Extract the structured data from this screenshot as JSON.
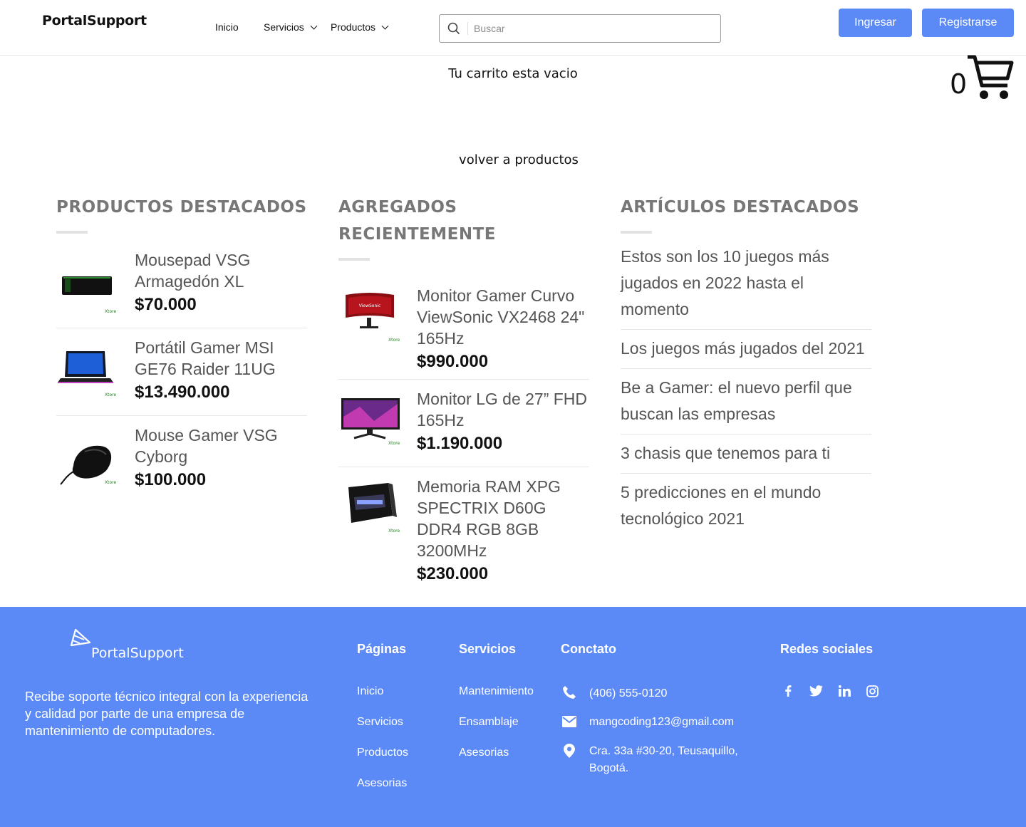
{
  "header": {
    "logo": "PortalSupport",
    "nav": [
      {
        "label": "Inicio"
      },
      {
        "label": "Servicios"
      },
      {
        "label": "Productos"
      }
    ],
    "search_placeholder": "Buscar",
    "login_label": "Ingresar",
    "register_label": "Registrarse"
  },
  "cart": {
    "empty_message": "Tu carrito esta vacio",
    "count": "0",
    "back_link": "volver a productos"
  },
  "featured": {
    "title": "PRODUCTOS DESTACADOS",
    "items": [
      {
        "name": "Mousepad VSG Armagedón XL",
        "price": "$70.000"
      },
      {
        "name": "Portátil Gamer MSI GE76 Raider 11UG",
        "price": "$13.490.000"
      },
      {
        "name": "Mouse Gamer VSG Cyborg",
        "price": "$100.000"
      }
    ]
  },
  "recent": {
    "title": "AGREGADOS RECIENTEMENTE",
    "items": [
      {
        "name": "Monitor Gamer Curvo ViewSonic VX2468 24\" 165Hz",
        "price": "$990.000"
      },
      {
        "name": "Monitor LG de 27” FHD 165Hz",
        "price": "$1.190.000"
      },
      {
        "name": "Memoria RAM XPG SPECTRIX D60G DDR4 RGB 8GB 3200MHz",
        "price": "$230.000"
      }
    ]
  },
  "articles": {
    "title": "ARTÍCULOS DESTACADOS",
    "items": [
      "Estos son los 10 juegos más jugados en 2022 hasta el momento",
      "Los juegos más jugados del 2021",
      "Be a Gamer: el nuevo perfil que buscan las empresas",
      "3 chasis que tenemos para ti",
      "5 predicciones en el mundo tecnológico 2021"
    ]
  },
  "footer": {
    "logo": "PortalSupport",
    "description": "Recibe soporte técnico integral con la experiencia y calidad por parte de una empresa de mantenimiento de computadores.",
    "pages_title": "Páginas",
    "pages": [
      "Inicio",
      "Servicios",
      "Productos",
      "Asesorias"
    ],
    "services_title": "Servicios",
    "services": [
      "Mantenimiento",
      "Ensamblaje",
      "Asesorias"
    ],
    "contact_title": "Conctato",
    "phone": "(406) 555-0120",
    "email": "mangcoding123@gmail.com",
    "address": "Cra. 33a #30-20, Teusaquillo, Bogotá.",
    "social_title": "Redes sociales",
    "social": [
      "facebook-icon",
      "twitter-icon",
      "linkedin-icon",
      "instagram-icon"
    ]
  },
  "colors": {
    "accent": "#5b8af7",
    "heading_gray": "#777777"
  }
}
